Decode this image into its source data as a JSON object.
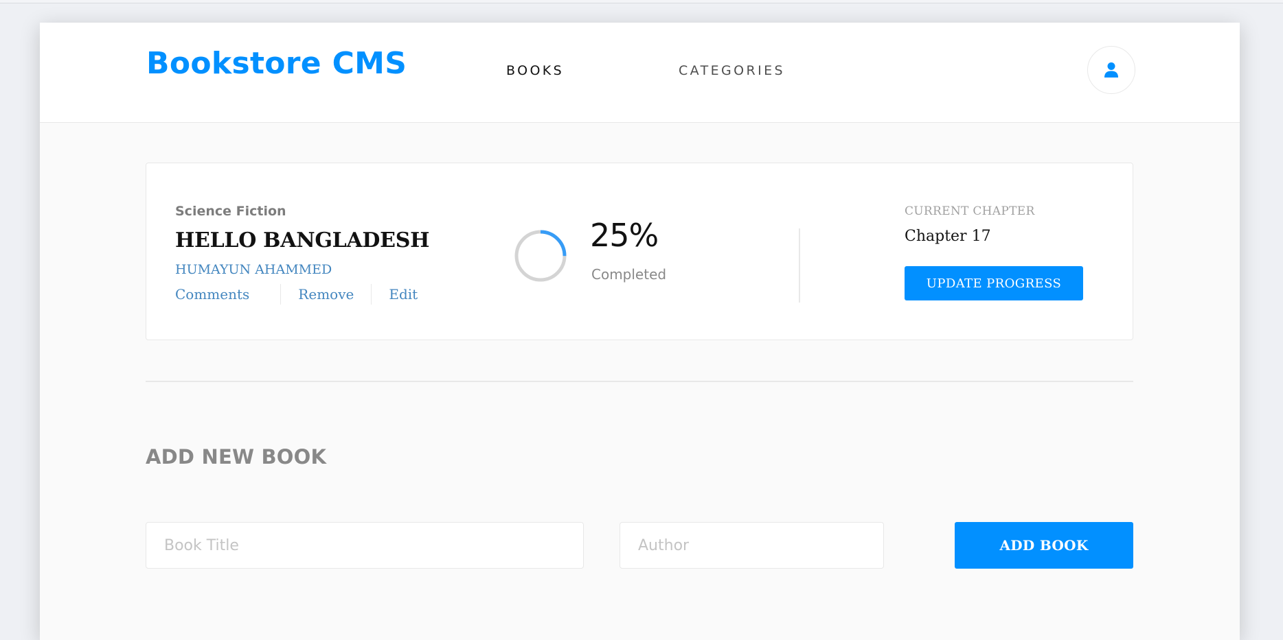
{
  "app": {
    "brand": "Bookstore CMS",
    "accent_color": "#0290ff"
  },
  "nav": {
    "items": [
      {
        "label": "BOOKS"
      },
      {
        "label": "CATEGORIES"
      }
    ],
    "user_icon": "user-icon"
  },
  "books": [
    {
      "genre": "Science Fiction",
      "title": "HELLO BANGLADESH",
      "author": "HUMAYUN AHAMMED",
      "actions": [
        "Comments",
        "Remove",
        "Edit"
      ],
      "progress_percent": 25,
      "progress_label": "25%",
      "completed_label": "Completed",
      "current_chapter_label": "CURRENT CHAPTER",
      "current_chapter": "Chapter 17",
      "update_button": "UPDATE PROGRESS"
    }
  ],
  "add_book": {
    "heading": "ADD NEW BOOK",
    "title_placeholder": "Book Title",
    "author_placeholder": "Author",
    "submit_label": "ADD BOOK"
  }
}
